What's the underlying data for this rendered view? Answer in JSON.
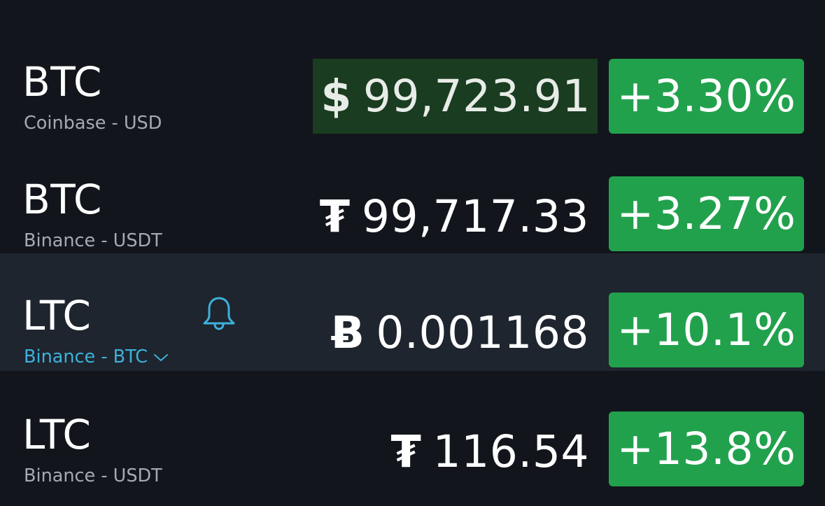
{
  "rows": [
    {
      "symbol": "BTC",
      "exchange": "Coinbase - USD",
      "currency_symbol": "$",
      "price": "99,723.91",
      "change": "+3.30%",
      "highlighted_price": true
    },
    {
      "symbol": "BTC",
      "exchange": "Binance - USDT",
      "currency_symbol": "₮",
      "price": "99,717.33",
      "change": "+3.27%"
    },
    {
      "symbol": "LTC",
      "exchange": "Binance - BTC",
      "currency_symbol": "Ƀ",
      "price": "0.001168",
      "change": "+10.1%",
      "selected": true,
      "has_alert_bell": true,
      "exchange_dropdown": true
    },
    {
      "symbol": "LTC",
      "exchange": "Binance - USDT",
      "currency_symbol": "₮",
      "price": "116.54",
      "change": "+13.8%"
    }
  ],
  "colors": {
    "background": "#12161c",
    "selected_row": "#1e252e",
    "positive_badge": "#22a14d",
    "price_flash": "#1a3c20",
    "accent_link": "#3eb1db",
    "muted_text": "#a5aab1"
  },
  "icons": {
    "alert": "bell-icon",
    "dropdown": "chevron-down-icon"
  }
}
